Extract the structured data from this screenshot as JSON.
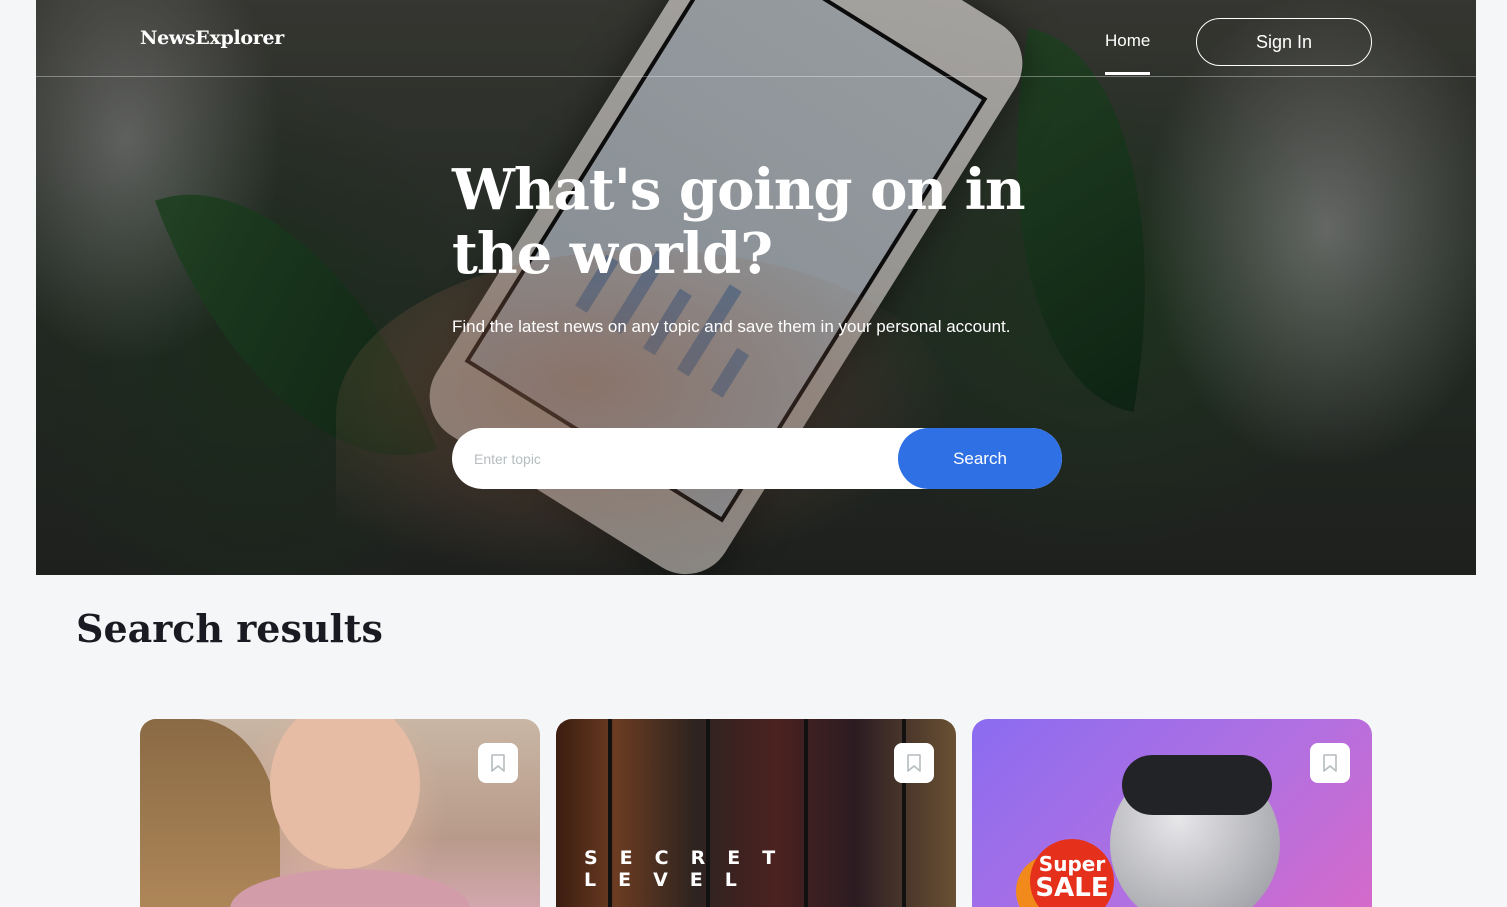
{
  "header": {
    "logo": "NewsExplorer",
    "nav": {
      "home": "Home"
    },
    "sign_in_label": "Sign In"
  },
  "hero": {
    "title": "What's going on in the world?",
    "subtitle": "Find the latest news on any topic and save them in your personal account.",
    "search": {
      "placeholder": "Enter topic",
      "value": "",
      "button_label": "Search"
    }
  },
  "results": {
    "title": "Search results",
    "cards": [
      {
        "image": "portrait-photo",
        "icon": "bookmark-icon"
      },
      {
        "image": "secret-level-poster",
        "poster_text": "SECRET LEVEL",
        "icon": "bookmark-icon"
      },
      {
        "image": "earbuds-sale-photo",
        "badge_line1": "Super",
        "badge_line2": "SALE",
        "icon": "bookmark-icon"
      }
    ]
  },
  "colors": {
    "accent": "#2f71e5",
    "background": "#f5f6f7",
    "title": "#1a1b22"
  }
}
